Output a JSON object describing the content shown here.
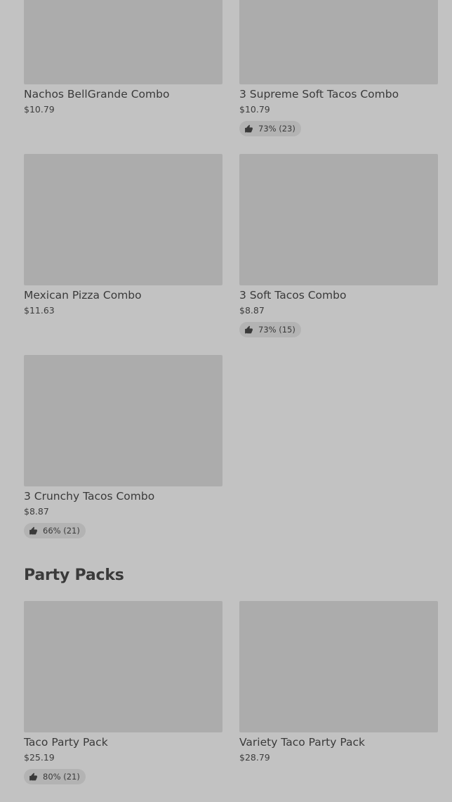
{
  "combos": [
    {
      "name": "Nachos BellGrande Combo",
      "price": "$10.79",
      "rating": ""
    },
    {
      "name": "3 Supreme Soft Tacos Combo",
      "price": "$10.79",
      "rating": "73% (23)"
    },
    {
      "name": "Mexican Pizza Combo",
      "price": "$11.63",
      "rating": ""
    },
    {
      "name": "3 Soft Tacos Combo",
      "price": "$8.87",
      "rating": "73% (15)"
    },
    {
      "name": "3 Crunchy Tacos Combo",
      "price": "$8.87",
      "rating": "66% (21)"
    }
  ],
  "party_packs": {
    "title": "Party Packs",
    "items": [
      {
        "name": "Taco Party Pack",
        "price": "$25.19",
        "rating": "80% (21)"
      },
      {
        "name": "Variety Taco Party Pack",
        "price": "$28.79",
        "rating": ""
      }
    ]
  },
  "icons": {
    "rating": "thumbs-up-icon"
  },
  "colors": {
    "background": "#c2c2c2",
    "image_placeholder": "#acacac",
    "badge": "#b3b3b3"
  }
}
